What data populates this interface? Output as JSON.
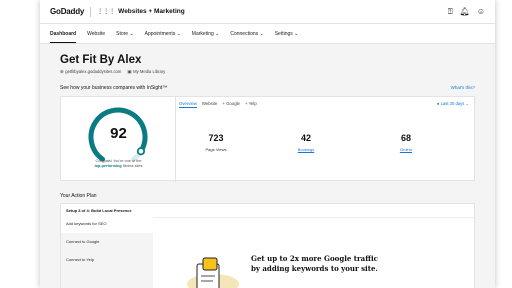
{
  "header": {
    "logo": "GoDaddy",
    "app_title": "Websites + Marketing",
    "icons": [
      "help-icon",
      "bell-icon",
      "user-icon"
    ]
  },
  "nav": {
    "items": [
      {
        "label": "Dashboard",
        "active": true
      },
      {
        "label": "Website"
      },
      {
        "label": "Store ⌄"
      },
      {
        "label": "Appointments ⌄"
      },
      {
        "label": "Marketing ⌄"
      },
      {
        "label": "Connections ⌄"
      },
      {
        "label": "Settings ⌄"
      }
    ]
  },
  "site": {
    "title": "Get Fit By Alex",
    "domain": "getfitbyalex.godaddysites.com",
    "media_library": "My Media Library"
  },
  "insight": {
    "heading": "See how your business compares with InSight™",
    "whats_this": "What's this?",
    "score": "92",
    "score_fraction": 0.92,
    "congrats_prefix": "Congrats! You're one of the",
    "congrats_bold": "top-performing",
    "congrats_suffix": "fitness sites",
    "tabs": [
      "Overview",
      "Website",
      "+ Google",
      "+ Yelp"
    ],
    "range": "Last 30 days ⌄",
    "stats": [
      {
        "value": "723",
        "label": "Page Views",
        "link": false
      },
      {
        "value": "42",
        "label": "Bookings",
        "link": true
      },
      {
        "value": "68",
        "label": "Orders",
        "link": true
      }
    ],
    "accent": "#0a7b83"
  },
  "action_plan": {
    "title": "Your Action Plan",
    "step": "Setup 3 of 4: Build Local Presence",
    "items": [
      "Add keywords for SEO",
      "Connect to Google",
      "Connect to Yelp"
    ],
    "promo_line1": "Get up to 2x more Google traffic",
    "promo_line2": "by adding keywords to your site."
  }
}
